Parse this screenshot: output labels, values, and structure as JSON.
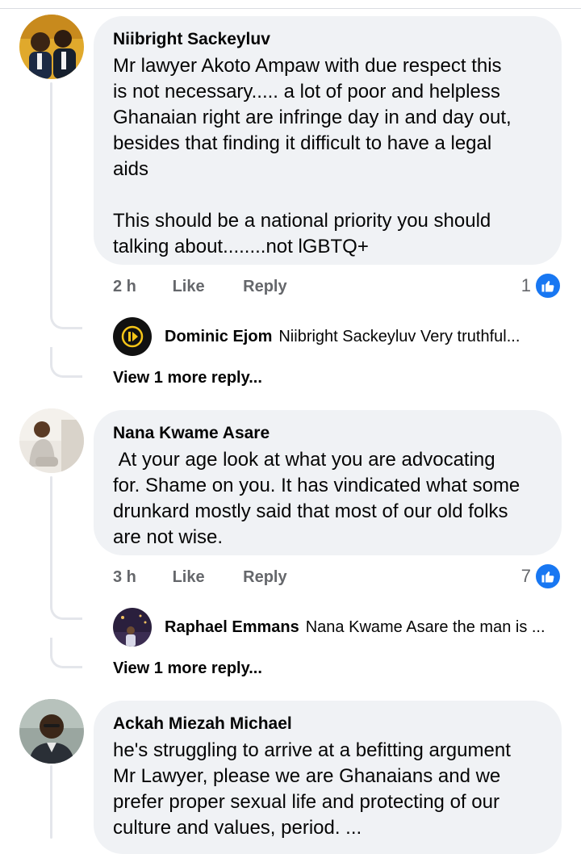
{
  "comments": [
    {
      "author": "Niibright Sackeyluv",
      "text": "Mr lawyer Akoto Ampaw with due respect this\nis not necessary..... a lot of poor and helpless\nGhanaian right are infringe day in and day out,\nbesides that finding it difficult to have a legal\naids\n\nThis should be a national priority you should\ntalking about........not lGBTQ+",
      "time": "2 h",
      "like_label": "Like",
      "reply_label": "Reply",
      "reaction_count": "1",
      "reply": {
        "author": "Dominic Ejom",
        "text": "Niibright Sackeyluv Very truthful..."
      },
      "view_more": "View 1 more reply..."
    },
    {
      "author": "Nana Kwame Asare",
      "text": " At your age look at what you are advocating\nfor. Shame on you. It has vindicated what some\ndrunkard mostly said that most of our old folks\nare not wise.",
      "time": "3 h",
      "like_label": "Like",
      "reply_label": "Reply",
      "reaction_count": "7",
      "reply": {
        "author": "Raphael Emmans",
        "text": "Nana Kwame Asare the man is ..."
      },
      "view_more": "View 1 more reply..."
    },
    {
      "author": "Ackah Miezah Michael",
      "text": "he's struggling to arrive at a befitting argument\nMr Lawyer, please we are Ghanaians and we\nprefer proper sexual life and protecting of our\nculture and values, period. ..."
    }
  ],
  "colors": {
    "bubble": "#f0f2f5",
    "meta_text": "#65676b",
    "like_blue": "#1877f2",
    "thread_line": "#e4e6eb"
  },
  "icons": {
    "reaction": "like-thumbs-up-icon"
  }
}
